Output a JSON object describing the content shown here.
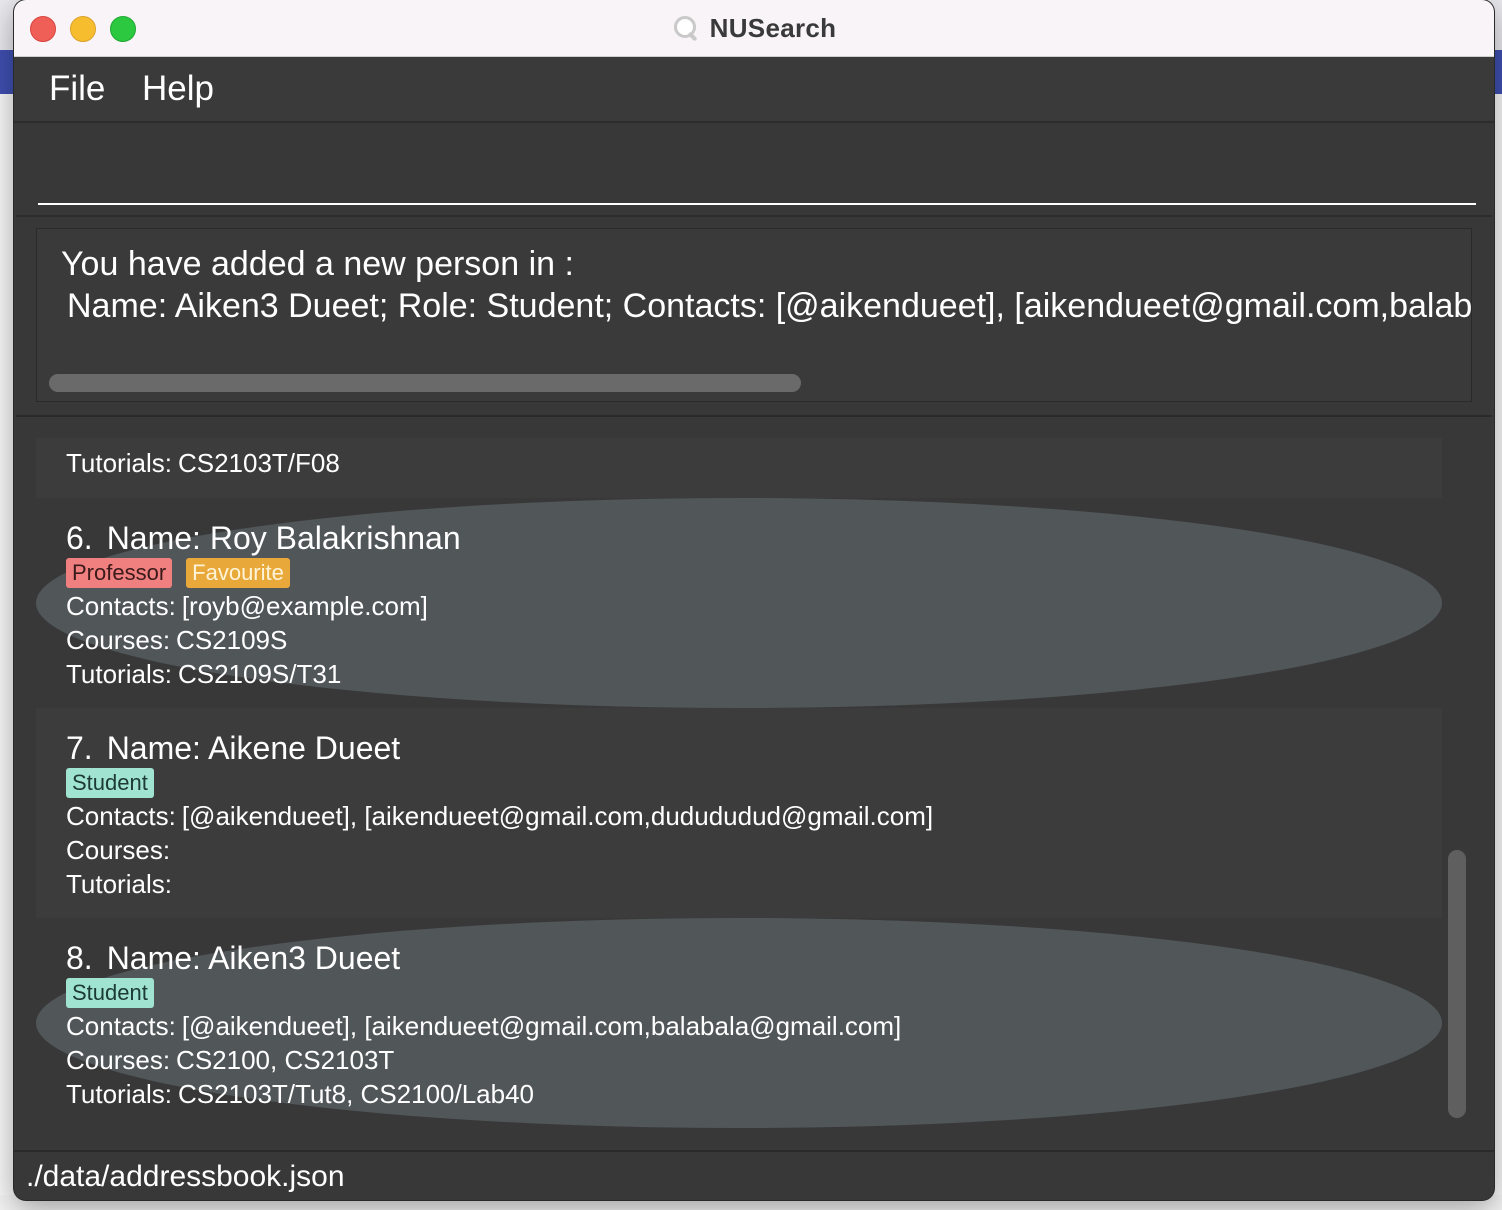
{
  "window": {
    "title": "NUSearch"
  },
  "menu": {
    "file": "File",
    "help": "Help"
  },
  "command": {
    "value": "",
    "placeholder": ""
  },
  "result": {
    "line1": "You have added a new person in :",
    "line2": "Name: Aiken3 Dueet; Role: Student; Contacts: [@aikendueet], [aikendueet@gmail.com,balabala@gmail.com]"
  },
  "persons": [
    {
      "index": "",
      "name": "",
      "tags": [],
      "contacts": "",
      "courses": "",
      "tutorials": "CS2103T/F08"
    },
    {
      "index": "6.",
      "name": "Roy Balakrishnan",
      "tags": [
        "Professor",
        "Favourite"
      ],
      "contacts": "[royb@example.com]",
      "courses": "CS2109S",
      "tutorials": "CS2109S/T31"
    },
    {
      "index": "7.",
      "name": "Aikene Dueet",
      "tags": [
        "Student"
      ],
      "contacts": "[@aikendueet], [aikendueet@gmail.com,dudududud@gmail.com]",
      "courses": "",
      "tutorials": ""
    },
    {
      "index": "8.",
      "name": "Aiken3 Dueet",
      "tags": [
        "Student"
      ],
      "contacts": "[@aikendueet], [aikendueet@gmail.com,balabala@gmail.com]",
      "courses": "CS2100, CS2103T",
      "tutorials": "CS2103T/Tut8, CS2100/Lab40"
    }
  ],
  "labels": {
    "name": "Name:",
    "contacts": "Contacts:",
    "courses": "Courses:",
    "tutorials": "Tutorials:"
  },
  "status": {
    "path": "./data/addressbook.json"
  }
}
